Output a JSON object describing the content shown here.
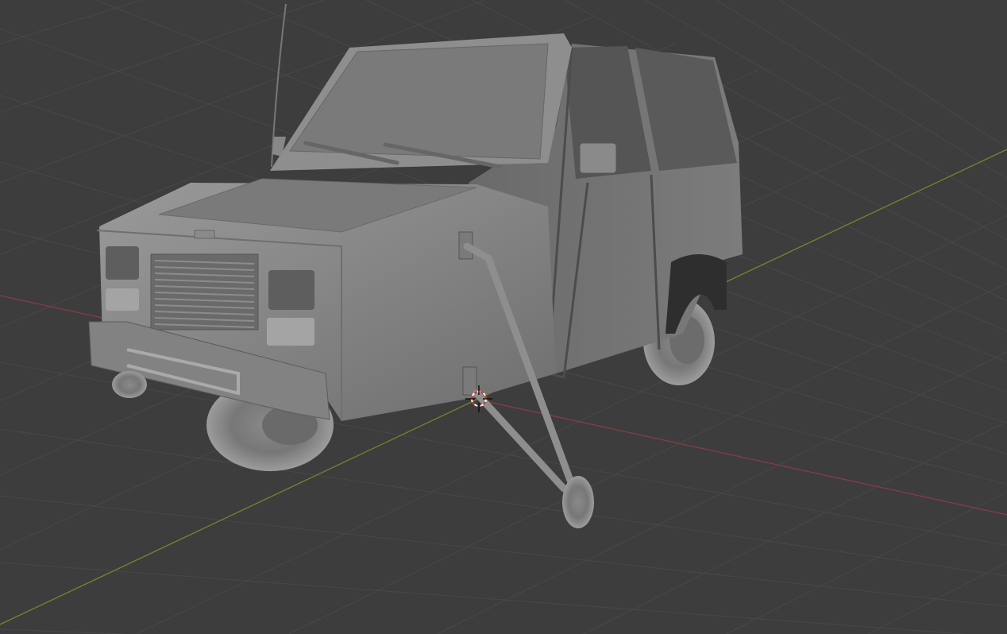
{
  "viewport": {
    "mode": "3d-viewport-solid-shading",
    "colors": {
      "background": "#3d3d3d",
      "grid": "#484848",
      "x_axis": "#8a3a45",
      "y_axis": "#6a8a2a",
      "model": "#8a8a8a",
      "cursor_red": "#e03030"
    },
    "objects": [
      {
        "name": "van-model",
        "icon": "mesh-object"
      },
      {
        "name": "3d-cursor",
        "icon": "crosshair-cursor-icon"
      }
    ]
  }
}
